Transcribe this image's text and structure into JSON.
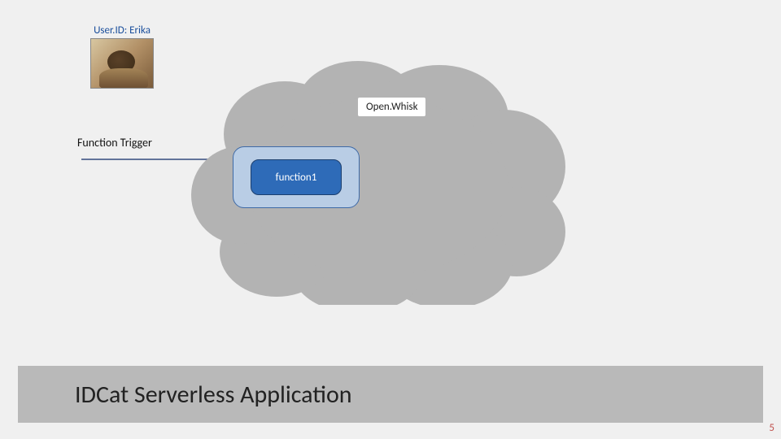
{
  "user": {
    "label": "User.ID: Erika",
    "image_name": "cat-photo"
  },
  "cloud": {
    "label": "Open.Whisk"
  },
  "trigger": {
    "label": "Function Trigger"
  },
  "function_container": {
    "function_label": "function1"
  },
  "title": "IDCat Serverless Application",
  "page_number": "5",
  "colors": {
    "cloud_fill": "#b3b3b3",
    "container_fill": "#b9cde5",
    "container_stroke": "#3e6aa7",
    "function_fill": "#2e6bb8",
    "arrow_color": "#334a7d",
    "title_bar": "#b9b9b9",
    "user_label": "#1b4f9c",
    "page_num_color": "#c0504d"
  }
}
